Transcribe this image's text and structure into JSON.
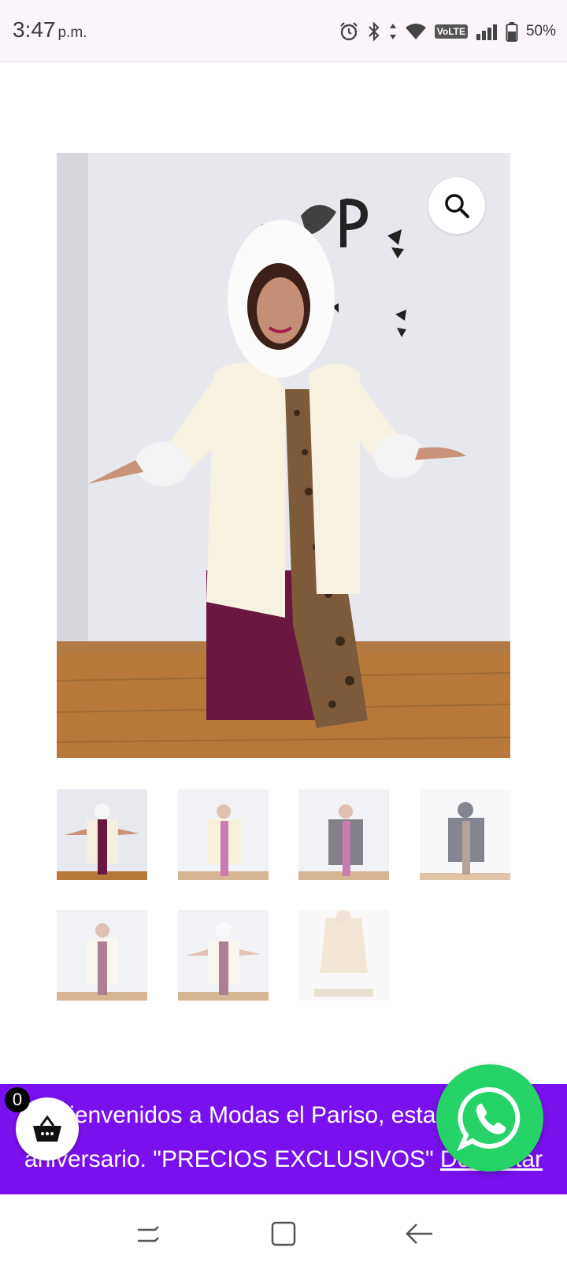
{
  "status_bar": {
    "time": "3:47",
    "ampm": "p.m.",
    "network_label": "VoLTE",
    "battery": "50%",
    "icons": [
      "alarm-icon",
      "bluetooth-icon",
      "data-arrows-icon",
      "wifi-icon",
      "signal-icon",
      "battery-icon"
    ]
  },
  "product": {
    "zoom_icon": "search-icon",
    "thumbnails_count": 7
  },
  "cart": {
    "count": "0",
    "icon": "basket-icon"
  },
  "store_notice": {
    "line1": "Bienvenidos a Modas el Pariso, estamos de",
    "line2": "aniversario. \"PRECIOS EXCLUSIVOS\" ",
    "dismiss": "Descartar"
  },
  "whatsapp": {
    "icon": "whatsapp-icon"
  },
  "nav": {
    "icons": [
      "recents-icon",
      "home-icon",
      "back-icon"
    ]
  },
  "colors": {
    "notice_bg": "#7a10ee",
    "whatsapp": "#25d366",
    "status_bg": "#fdf5fc"
  }
}
